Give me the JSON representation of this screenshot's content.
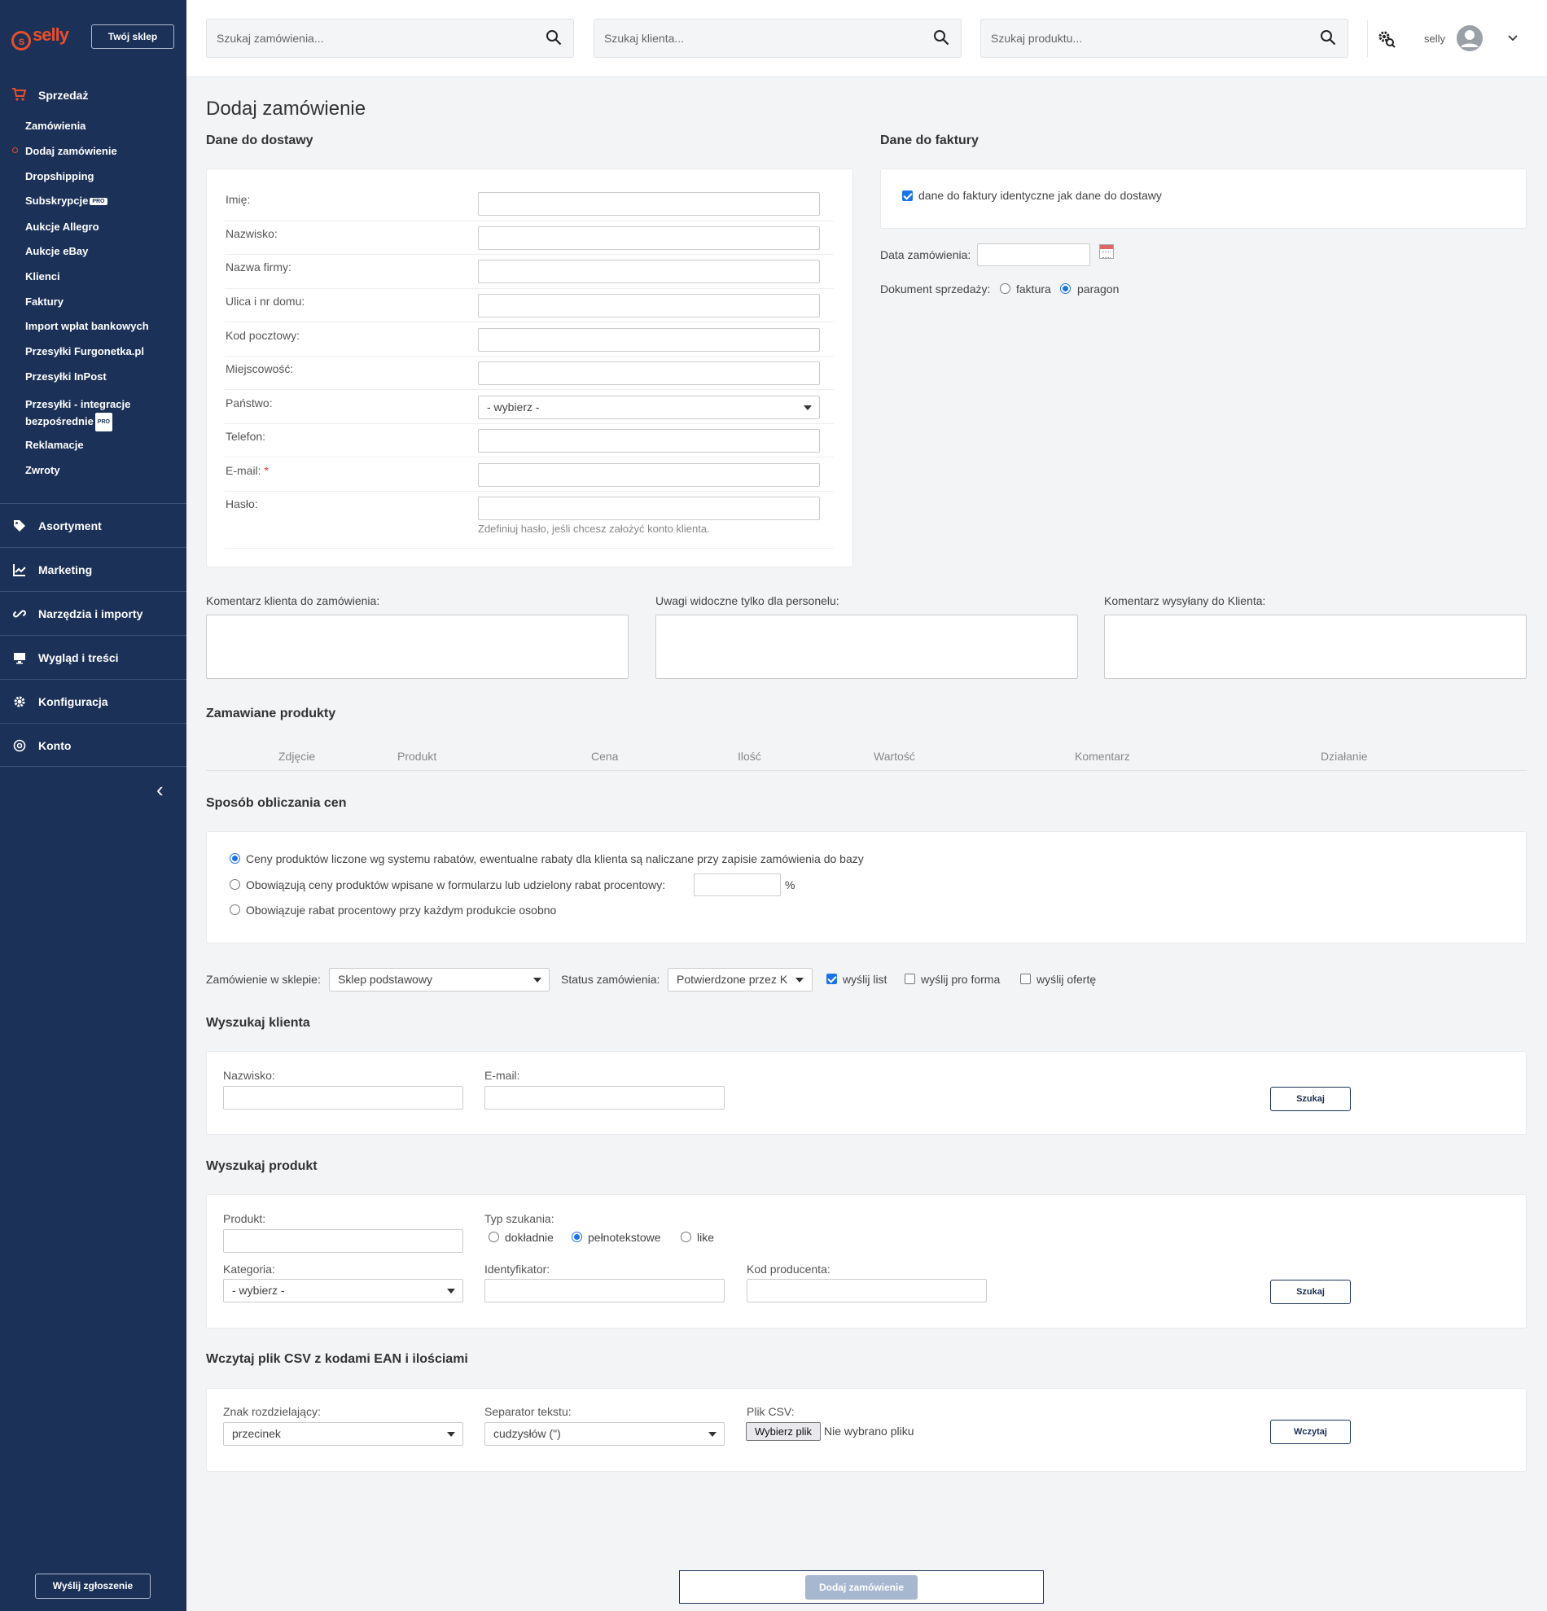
{
  "brand": {
    "logo": "selly",
    "shop_button": "Twój sklep"
  },
  "sidebar": {
    "sales_section": "Sprzedaż",
    "sales_items": [
      {
        "label": "Zamówienia",
        "badge": ""
      },
      {
        "label": "Dodaj zamówienie",
        "badge": ""
      },
      {
        "label": "Dropshipping",
        "badge": ""
      },
      {
        "label": "Subskrypcje",
        "badge": "PRO"
      },
      {
        "label": "Aukcje Allegro",
        "badge": ""
      },
      {
        "label": "Aukcje eBay",
        "badge": ""
      },
      {
        "label": "Klienci",
        "badge": ""
      },
      {
        "label": "Faktury",
        "badge": ""
      },
      {
        "label": "Import wpłat bankowych",
        "badge": ""
      },
      {
        "label": "Przesyłki Furgonetka.pl",
        "badge": ""
      },
      {
        "label": "Przesyłki InPost",
        "badge": ""
      },
      {
        "label": "Przesyłki - integracje",
        "label2": "bezpośrednie",
        "badge": "PRO"
      },
      {
        "label": "Reklamacje",
        "badge": ""
      },
      {
        "label": "Zwroty",
        "badge": ""
      }
    ],
    "active_item": "Dodaj zamówienie",
    "sections": [
      {
        "label": "Asortyment",
        "icon": "tag-icon"
      },
      {
        "label": "Marketing",
        "icon": "chart-line-icon"
      },
      {
        "label": "Narzędzia i importy",
        "icon": "link-icon"
      },
      {
        "label": "Wygląd i treści",
        "icon": "monitor-icon"
      },
      {
        "label": "Konfiguracja",
        "icon": "gear-icon"
      },
      {
        "label": "Konto",
        "icon": "account-circle-icon"
      }
    ],
    "report_button": "Wyślij zgłoszenie"
  },
  "topbar": {
    "search_orders_placeholder": "Szukaj zamówienia...",
    "search_clients_placeholder": "Szukaj klienta...",
    "search_products_placeholder": "Szukaj produktu...",
    "username": "selly"
  },
  "page": {
    "title": "Dodaj zamówienie",
    "delivery_title": "Dane do dostawy",
    "delivery_fields": [
      {
        "label": "Imię:",
        "type": "input",
        "value": ""
      },
      {
        "label": "Nazwisko:",
        "type": "input",
        "value": ""
      },
      {
        "label": "Nazwa firmy:",
        "type": "input",
        "value": ""
      },
      {
        "label": "Ulica i nr domu:",
        "type": "input",
        "value": ""
      },
      {
        "label": "Kod pocztowy:",
        "type": "input",
        "value": ""
      },
      {
        "label": "Miejscowość:",
        "type": "input",
        "value": ""
      },
      {
        "label": "Państwo:",
        "type": "select",
        "value": "- wybierz -"
      },
      {
        "label": "Telefon:",
        "type": "input",
        "value": ""
      },
      {
        "label": "E-mail:",
        "type": "input",
        "value": "",
        "required": "*"
      },
      {
        "label": "Hasło:",
        "type": "input",
        "value": ""
      }
    ],
    "password_hint": "Zdefiniuj hasło, jeśli chcesz założyć konto klienta.",
    "invoice_title": "Dane do faktury",
    "invoice_same_label": "dane do faktury identyczne jak dane do dostawy",
    "invoice_same_checked": true,
    "order_date_label": "Data zamówienia:",
    "order_date_value": "",
    "sales_doc_label": "Dokument sprzedaży:",
    "sales_doc_options": [
      "faktura",
      "paragon"
    ],
    "sales_doc_selected": "paragon",
    "comment_client_label": "Komentarz klienta do zamówienia:",
    "comment_staff_label": "Uwagi widoczne tylko dla personelu:",
    "comment_sent_label": "Komentarz wysyłany do Klienta:",
    "ordered_products_title": "Zamawiane produkty",
    "products_columns": [
      "Zdjęcie",
      "Produkt",
      "Cena",
      "Ilość",
      "Wartość",
      "Komentarz",
      "Działanie"
    ],
    "pricing_title": "Sposób obliczania cen",
    "pricing_options": [
      "Ceny produktów liczone wg systemu rabatów, ewentualne rabaty dla klienta są naliczane przy zapisie zamówienia do bazy",
      "Obowiązują ceny produktów wpisane w formularzu lub udzielony rabat procentowy:",
      "Obowiązuje rabat procentowy przy każdym produkcie osobno"
    ],
    "pricing_selected": 0,
    "pricing_percent_unit": "%",
    "shop_label": "Zamówienie w sklepie:",
    "shop_value": "Sklep podstawowy",
    "status_label": "Status zamówienia:",
    "status_value": "Potwierdzone przez K",
    "send_letter": "wyślij list",
    "send_letter_checked": true,
    "send_proforma": "wyślij pro forma",
    "send_proforma_checked": false,
    "send_offer": "wyślij ofertę",
    "send_offer_checked": false,
    "search_client_title": "Wyszukaj klienta",
    "client_lastname_label": "Nazwisko:",
    "client_email_label": "E-mail:",
    "search_button": "Szukaj",
    "search_product_title": "Wyszukaj produkt",
    "product_label": "Produkt:",
    "search_type_label": "Typ szukania:",
    "search_type_options": [
      "dokładnie",
      "pełnotekstowe",
      "like"
    ],
    "search_type_selected": "pełnotekstowe",
    "category_label": "Kategoria:",
    "category_value": "- wybierz -",
    "identifier_label": "Identyfikator:",
    "producer_code_label": "Kod producenta:",
    "csv_title": "Wczytaj plik CSV z kodami EAN i ilościami",
    "delimiter_label": "Znak rozdzielający:",
    "delimiter_value": "przecinek",
    "text_sep_label": "Separator tekstu:",
    "text_sep_value": "cudzysłów (\")",
    "csv_file_label": "Plik CSV:",
    "choose_file": "Wybierz plik",
    "no_file": "Nie wybrano pliku",
    "load_button": "Wczytaj",
    "add_order_button": "Dodaj zamówienie"
  },
  "colors": {
    "sidebar_bg": "#1b3157",
    "brand": "#e94e2a",
    "accent": "#1a73e8"
  }
}
